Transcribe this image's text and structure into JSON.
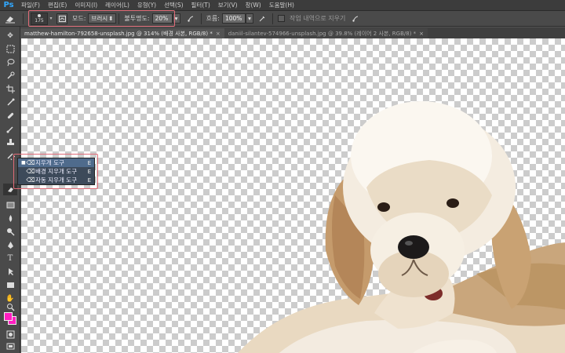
{
  "app": {
    "logo": "Ps",
    "accent": "#31a8ff"
  },
  "menu": [
    "파일(F)",
    "편집(E)",
    "이미지(I)",
    "레이어(L)",
    "유형(Y)",
    "선택(S)",
    "필터(T)",
    "보기(V)",
    "창(W)",
    "도움말(H)"
  ],
  "options": {
    "tool_icon": "eraser-icon",
    "brush_size": "175",
    "mode_label": "모드:",
    "mode_value": "브러시",
    "opacity_label": "불투명도:",
    "opacity_value": "20%",
    "flow_label": "흐름:",
    "flow_value": "100%",
    "history_label": "작업 내역으로 지우기"
  },
  "tabs": [
    {
      "label": "matthew-hamilton-792658-unsplash.jpg @ 314% (배경 사본, RGB/8) *",
      "active": true
    },
    {
      "label": "daniil-silantev-574966-unsplash.jpg @ 39.8% (레이어 2 사본, RGB/8) *",
      "active": false
    }
  ],
  "flyout": [
    {
      "label": "지우개 도구",
      "key": "E",
      "icon": "eraser-icon",
      "selected": true
    },
    {
      "label": "배경 지우개 도구",
      "key": "E",
      "icon": "background-eraser-icon",
      "selected": false
    },
    {
      "label": "자동 지우개 도구",
      "key": "E",
      "icon": "magic-eraser-icon",
      "selected": false
    }
  ],
  "colors": {
    "foreground": "#ff1ec0",
    "background": "#ff1ec0",
    "highlight": "#e06b77"
  }
}
